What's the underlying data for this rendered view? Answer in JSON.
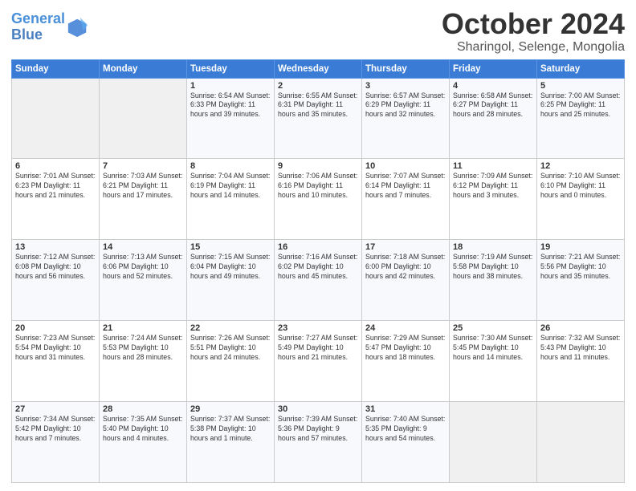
{
  "header": {
    "logo_line1": "General",
    "logo_line2": "Blue",
    "month": "October 2024",
    "location": "Sharingol, Selenge, Mongolia"
  },
  "days_of_week": [
    "Sunday",
    "Monday",
    "Tuesday",
    "Wednesday",
    "Thursday",
    "Friday",
    "Saturday"
  ],
  "weeks": [
    [
      {
        "day": "",
        "info": ""
      },
      {
        "day": "",
        "info": ""
      },
      {
        "day": "1",
        "info": "Sunrise: 6:54 AM\nSunset: 6:33 PM\nDaylight: 11 hours and 39 minutes."
      },
      {
        "day": "2",
        "info": "Sunrise: 6:55 AM\nSunset: 6:31 PM\nDaylight: 11 hours and 35 minutes."
      },
      {
        "day": "3",
        "info": "Sunrise: 6:57 AM\nSunset: 6:29 PM\nDaylight: 11 hours and 32 minutes."
      },
      {
        "day": "4",
        "info": "Sunrise: 6:58 AM\nSunset: 6:27 PM\nDaylight: 11 hours and 28 minutes."
      },
      {
        "day": "5",
        "info": "Sunrise: 7:00 AM\nSunset: 6:25 PM\nDaylight: 11 hours and 25 minutes."
      }
    ],
    [
      {
        "day": "6",
        "info": "Sunrise: 7:01 AM\nSunset: 6:23 PM\nDaylight: 11 hours and 21 minutes."
      },
      {
        "day": "7",
        "info": "Sunrise: 7:03 AM\nSunset: 6:21 PM\nDaylight: 11 hours and 17 minutes."
      },
      {
        "day": "8",
        "info": "Sunrise: 7:04 AM\nSunset: 6:19 PM\nDaylight: 11 hours and 14 minutes."
      },
      {
        "day": "9",
        "info": "Sunrise: 7:06 AM\nSunset: 6:16 PM\nDaylight: 11 hours and 10 minutes."
      },
      {
        "day": "10",
        "info": "Sunrise: 7:07 AM\nSunset: 6:14 PM\nDaylight: 11 hours and 7 minutes."
      },
      {
        "day": "11",
        "info": "Sunrise: 7:09 AM\nSunset: 6:12 PM\nDaylight: 11 hours and 3 minutes."
      },
      {
        "day": "12",
        "info": "Sunrise: 7:10 AM\nSunset: 6:10 PM\nDaylight: 11 hours and 0 minutes."
      }
    ],
    [
      {
        "day": "13",
        "info": "Sunrise: 7:12 AM\nSunset: 6:08 PM\nDaylight: 10 hours and 56 minutes."
      },
      {
        "day": "14",
        "info": "Sunrise: 7:13 AM\nSunset: 6:06 PM\nDaylight: 10 hours and 52 minutes."
      },
      {
        "day": "15",
        "info": "Sunrise: 7:15 AM\nSunset: 6:04 PM\nDaylight: 10 hours and 49 minutes."
      },
      {
        "day": "16",
        "info": "Sunrise: 7:16 AM\nSunset: 6:02 PM\nDaylight: 10 hours and 45 minutes."
      },
      {
        "day": "17",
        "info": "Sunrise: 7:18 AM\nSunset: 6:00 PM\nDaylight: 10 hours and 42 minutes."
      },
      {
        "day": "18",
        "info": "Sunrise: 7:19 AM\nSunset: 5:58 PM\nDaylight: 10 hours and 38 minutes."
      },
      {
        "day": "19",
        "info": "Sunrise: 7:21 AM\nSunset: 5:56 PM\nDaylight: 10 hours and 35 minutes."
      }
    ],
    [
      {
        "day": "20",
        "info": "Sunrise: 7:23 AM\nSunset: 5:54 PM\nDaylight: 10 hours and 31 minutes."
      },
      {
        "day": "21",
        "info": "Sunrise: 7:24 AM\nSunset: 5:53 PM\nDaylight: 10 hours and 28 minutes."
      },
      {
        "day": "22",
        "info": "Sunrise: 7:26 AM\nSunset: 5:51 PM\nDaylight: 10 hours and 24 minutes."
      },
      {
        "day": "23",
        "info": "Sunrise: 7:27 AM\nSunset: 5:49 PM\nDaylight: 10 hours and 21 minutes."
      },
      {
        "day": "24",
        "info": "Sunrise: 7:29 AM\nSunset: 5:47 PM\nDaylight: 10 hours and 18 minutes."
      },
      {
        "day": "25",
        "info": "Sunrise: 7:30 AM\nSunset: 5:45 PM\nDaylight: 10 hours and 14 minutes."
      },
      {
        "day": "26",
        "info": "Sunrise: 7:32 AM\nSunset: 5:43 PM\nDaylight: 10 hours and 11 minutes."
      }
    ],
    [
      {
        "day": "27",
        "info": "Sunrise: 7:34 AM\nSunset: 5:42 PM\nDaylight: 10 hours and 7 minutes."
      },
      {
        "day": "28",
        "info": "Sunrise: 7:35 AM\nSunset: 5:40 PM\nDaylight: 10 hours and 4 minutes."
      },
      {
        "day": "29",
        "info": "Sunrise: 7:37 AM\nSunset: 5:38 PM\nDaylight: 10 hours and 1 minute."
      },
      {
        "day": "30",
        "info": "Sunrise: 7:39 AM\nSunset: 5:36 PM\nDaylight: 9 hours and 57 minutes."
      },
      {
        "day": "31",
        "info": "Sunrise: 7:40 AM\nSunset: 5:35 PM\nDaylight: 9 hours and 54 minutes."
      },
      {
        "day": "",
        "info": ""
      },
      {
        "day": "",
        "info": ""
      }
    ]
  ]
}
